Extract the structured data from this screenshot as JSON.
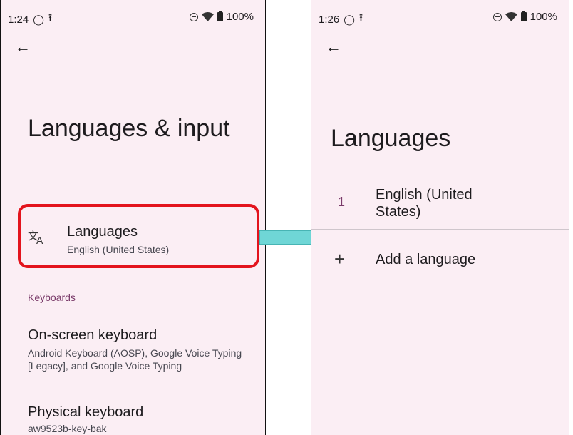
{
  "left": {
    "status": {
      "time": "1:24",
      "battery": "100%"
    },
    "title": "Languages & input",
    "languages": {
      "title": "Languages",
      "subtitle": "English (United States)"
    },
    "section_keyboards": "Keyboards",
    "onscreen": {
      "title": "On-screen keyboard",
      "subtitle": "Android Keyboard (AOSP), Google Voice Typing [Legacy], and Google Voice Typing"
    },
    "physical": {
      "title": "Physical keyboard",
      "subtitle": "aw9523b-key-bak"
    }
  },
  "right": {
    "status": {
      "time": "1:26",
      "battery": "100%"
    },
    "title": "Languages",
    "language_list": [
      {
        "index": "1",
        "name": "English (United States)"
      }
    ],
    "add_language": "Add a language"
  },
  "icons": {
    "back": "back-arrow-icon",
    "translate": "translate-icon",
    "add": "plus-icon",
    "dnd": "do-not-disturb-icon",
    "wifi": "wifi-icon",
    "battery": "battery-icon",
    "upload": "upload-icon",
    "sim": "sim-icon"
  },
  "colors": {
    "phone_bg": "#fbeef4",
    "accent": "#7a3b6a",
    "highlight": "#e3141d",
    "arrow": "#6fd6d6"
  }
}
